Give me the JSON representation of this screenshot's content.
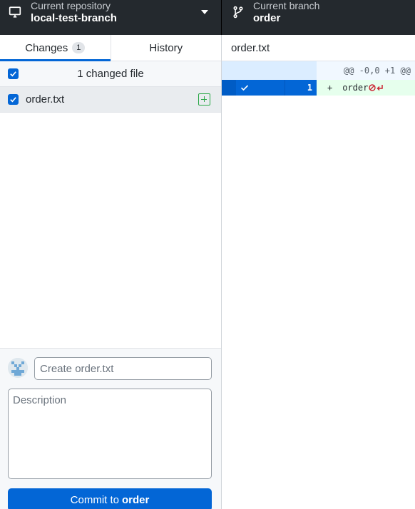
{
  "toolbar": {
    "repository": {
      "label": "Current repository",
      "value": "local-test-branch"
    },
    "branch": {
      "label": "Current branch",
      "value": "order"
    }
  },
  "sidebar": {
    "tabs": [
      {
        "label": "Changes",
        "badge": "1",
        "active": true
      },
      {
        "label": "History",
        "active": false
      }
    ],
    "changed_header": "1 changed file",
    "files": [
      {
        "name": "order.txt",
        "checked": true,
        "status": "added"
      }
    ]
  },
  "commit": {
    "summary_placeholder": "Create order.txt",
    "description_placeholder": "Description",
    "button_prefix": "Commit to",
    "button_branch": "order"
  },
  "diff": {
    "file": "order.txt",
    "hunk_header": "@@ -0,0 +1 @@",
    "lines": [
      {
        "new_line": "1",
        "sign": "+",
        "text": "order"
      }
    ]
  },
  "colors": {
    "toolbar_bg": "#24292e",
    "accent": "#0366d6",
    "added": "#28a745",
    "added_line_bg": "#e6ffed"
  }
}
